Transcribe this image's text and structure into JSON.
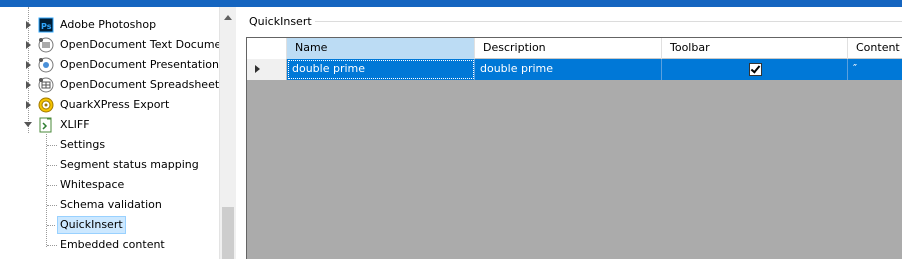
{
  "tree": {
    "items": [
      {
        "label": "Adobe Photoshop",
        "icon": "photoshop-icon"
      },
      {
        "label": "OpenDocument Text Documen",
        "icon": "opendocument-text-icon"
      },
      {
        "label": "OpenDocument Presentation (",
        "icon": "opendocument-presentation-icon"
      },
      {
        "label": "OpenDocument Spreadsheet (",
        "icon": "opendocument-spreadsheet-icon"
      },
      {
        "label": "QuarkXPress Export",
        "icon": "quarkxpress-icon"
      },
      {
        "label": "XLIFF",
        "icon": "xliff-icon"
      }
    ],
    "children": [
      {
        "label": "Settings"
      },
      {
        "label": "Segment status mapping"
      },
      {
        "label": "Whitespace"
      },
      {
        "label": "Schema validation"
      },
      {
        "label": "QuickInsert",
        "selected": true
      },
      {
        "label": "Embedded content"
      }
    ]
  },
  "panel": {
    "title": "QuickInsert"
  },
  "grid": {
    "columns": [
      "Name",
      "Description",
      "Toolbar",
      "Content"
    ],
    "active_column": "Name",
    "rows": [
      {
        "name": "double prime",
        "description": "double prime",
        "toolbar": true,
        "content": "″"
      }
    ]
  },
  "colors": {
    "accent": "#0078d7",
    "title_bar": "#1565c0",
    "grid_background": "#ababab",
    "selection_highlight": "#cce8ff"
  }
}
